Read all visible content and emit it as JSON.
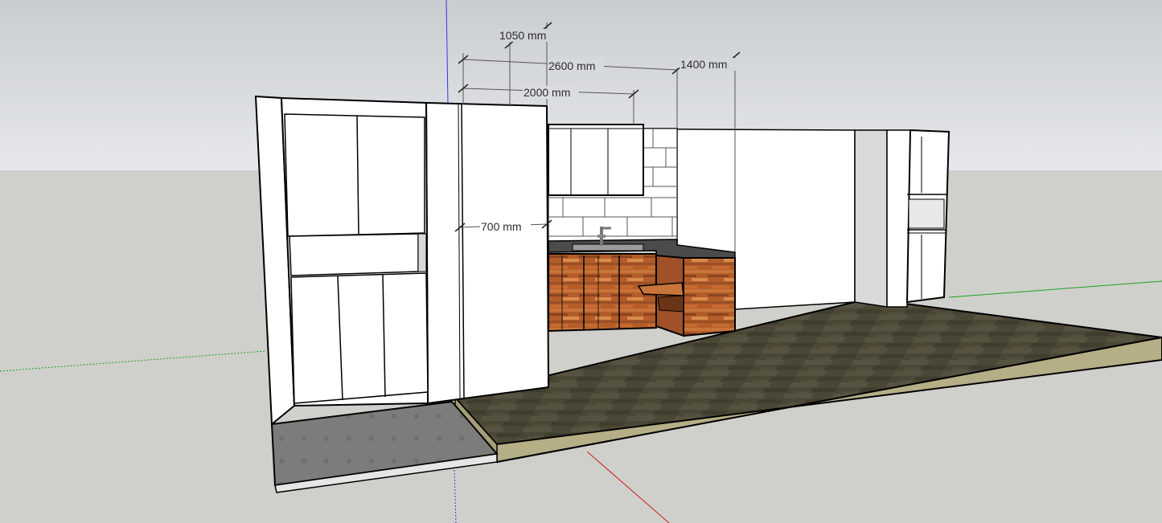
{
  "viewport": {
    "sky_color": "#dfe2e4",
    "ground_color": "#cfd0cc",
    "axis_colors": {
      "blue": "#3a35e0",
      "red": "#d01818",
      "green": "#1ea01e"
    }
  },
  "dimensions": [
    {
      "id": "dim-1050",
      "label": "1050 mm"
    },
    {
      "id": "dim-2600",
      "label": "2600 mm"
    },
    {
      "id": "dim-2000",
      "label": "2000 mm"
    },
    {
      "id": "dim-1400",
      "label": "1400 mm"
    },
    {
      "id": "dim-700",
      "label": "700 mm"
    }
  ],
  "materials": {
    "wood_floor": "#4a4736",
    "floor_edge": "#b5ae86",
    "tile_floor": "#7c7d7a",
    "wood_cabinet": "#b45d2a",
    "countertop": "#4b4b4b",
    "white_panel": "#ffffff",
    "wall_white": "#ffffff",
    "shadow_panel": "#d8d9d9"
  }
}
